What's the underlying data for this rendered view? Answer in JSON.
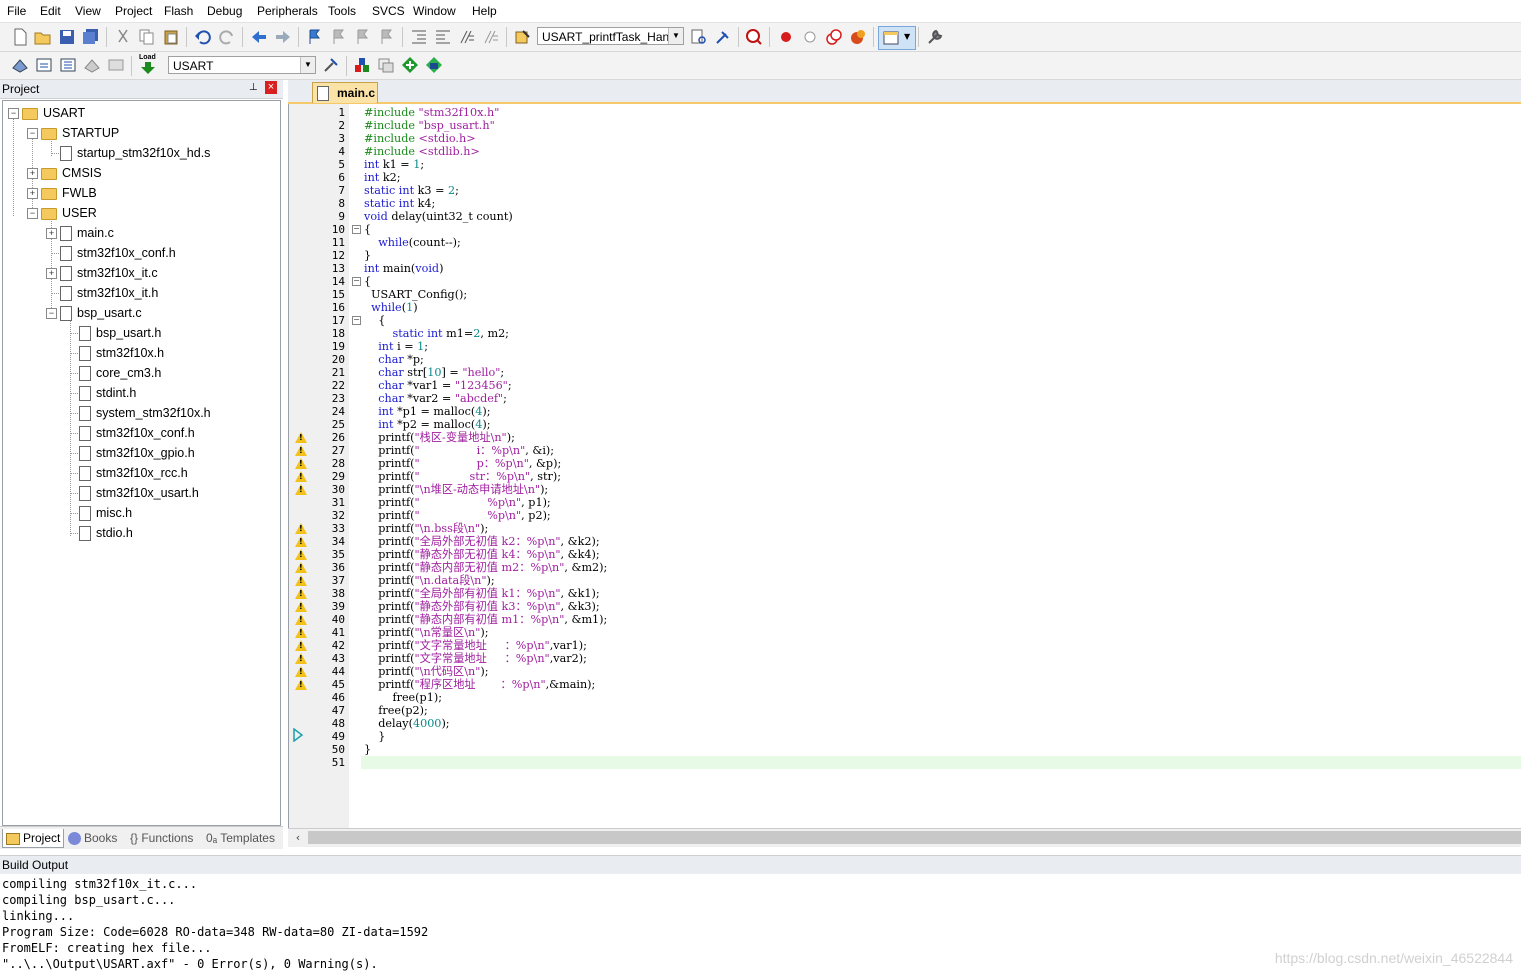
{
  "menu": [
    "File",
    "Edit",
    "View",
    "Project",
    "Flash",
    "Debug",
    "Peripherals",
    "Tools",
    "SVCS",
    "Window",
    "Help"
  ],
  "toolbar": {
    "function_combo": "USART_printfTask_Handl",
    "target_combo": "USART",
    "load_label": "Load"
  },
  "project_panel": {
    "title": "Project",
    "pin": "p",
    "close": "×",
    "tree": [
      {
        "label": "USART",
        "level": 0,
        "type": "root",
        "expander": "-"
      },
      {
        "label": "STARTUP",
        "level": 1,
        "type": "folder",
        "expander": "-"
      },
      {
        "label": "startup_stm32f10x_hd.s",
        "level": 2,
        "type": "file",
        "expander": ""
      },
      {
        "label": "CMSIS",
        "level": 1,
        "type": "folder",
        "expander": "+"
      },
      {
        "label": "FWLB",
        "level": 1,
        "type": "folder",
        "expander": "+"
      },
      {
        "label": "USER",
        "level": 1,
        "type": "folder",
        "expander": "-"
      },
      {
        "label": "main.c",
        "level": 2,
        "type": "file",
        "expander": "+"
      },
      {
        "label": "stm32f10x_conf.h",
        "level": 2,
        "type": "file",
        "expander": ""
      },
      {
        "label": "stm32f10x_it.c",
        "level": 2,
        "type": "file",
        "expander": "+"
      },
      {
        "label": "stm32f10x_it.h",
        "level": 2,
        "type": "file",
        "expander": ""
      },
      {
        "label": "bsp_usart.c",
        "level": 2,
        "type": "file",
        "expander": "-"
      },
      {
        "label": "bsp_usart.h",
        "level": 3,
        "type": "file",
        "expander": ""
      },
      {
        "label": "stm32f10x.h",
        "level": 3,
        "type": "file",
        "expander": ""
      },
      {
        "label": "core_cm3.h",
        "level": 3,
        "type": "file",
        "expander": ""
      },
      {
        "label": "stdint.h",
        "level": 3,
        "type": "file",
        "expander": ""
      },
      {
        "label": "system_stm32f10x.h",
        "level": 3,
        "type": "file",
        "expander": ""
      },
      {
        "label": "stm32f10x_conf.h",
        "level": 3,
        "type": "file",
        "expander": ""
      },
      {
        "label": "stm32f10x_gpio.h",
        "level": 3,
        "type": "file",
        "expander": ""
      },
      {
        "label": "stm32f10x_rcc.h",
        "level": 3,
        "type": "file",
        "expander": ""
      },
      {
        "label": "stm32f10x_usart.h",
        "level": 3,
        "type": "file",
        "expander": ""
      },
      {
        "label": "misc.h",
        "level": 3,
        "type": "file",
        "expander": ""
      },
      {
        "label": "stdio.h",
        "level": 3,
        "type": "file",
        "expander": ""
      }
    ],
    "tabs": [
      "Project",
      "Books",
      "{} Functions",
      "0ₐ Templates"
    ]
  },
  "editor": {
    "tab": "main.c",
    "lines": [
      {
        "n": "1",
        "w": false,
        "f": "",
        "t": [
          [
            "p",
            "#include "
          ],
          [
            "s",
            "\"stm32f10x.h\""
          ]
        ]
      },
      {
        "n": "2",
        "w": false,
        "f": "",
        "t": [
          [
            "p",
            "#include "
          ],
          [
            "s",
            "\"bsp_usart.h\""
          ]
        ]
      },
      {
        "n": "3",
        "w": false,
        "f": "",
        "t": [
          [
            "p",
            "#include "
          ],
          [
            "s",
            "<stdio.h>"
          ]
        ]
      },
      {
        "n": "4",
        "w": false,
        "f": "",
        "t": [
          [
            "p",
            "#include "
          ],
          [
            "s",
            "<stdlib.h>"
          ]
        ]
      },
      {
        "n": "5",
        "w": false,
        "f": "",
        "t": [
          [
            "k",
            "int"
          ],
          [
            "x",
            " k1 = "
          ],
          [
            "d",
            "1"
          ],
          [
            "x",
            ";"
          ]
        ]
      },
      {
        "n": "6",
        "w": false,
        "f": "",
        "t": [
          [
            "k",
            "int"
          ],
          [
            "x",
            " k2;"
          ]
        ]
      },
      {
        "n": "7",
        "w": false,
        "f": "",
        "t": [
          [
            "k",
            "static int"
          ],
          [
            "x",
            " k3 = "
          ],
          [
            "d",
            "2"
          ],
          [
            "x",
            ";"
          ]
        ]
      },
      {
        "n": "8",
        "w": false,
        "f": "",
        "t": [
          [
            "k",
            "static int"
          ],
          [
            "x",
            " k4;"
          ]
        ]
      },
      {
        "n": "9",
        "w": false,
        "f": "",
        "t": [
          [
            "k",
            "void"
          ],
          [
            "x",
            " delay(uint32_t count)"
          ]
        ]
      },
      {
        "n": "10",
        "w": false,
        "f": "-",
        "t": [
          [
            "x",
            "{"
          ]
        ]
      },
      {
        "n": "11",
        "w": false,
        "f": "",
        "t": [
          [
            "x",
            "    "
          ],
          [
            "k",
            "while"
          ],
          [
            "x",
            "(count--);"
          ]
        ]
      },
      {
        "n": "12",
        "w": false,
        "f": "",
        "t": [
          [
            "x",
            "}"
          ]
        ]
      },
      {
        "n": "13",
        "w": false,
        "f": "",
        "t": [
          [
            "k",
            "int"
          ],
          [
            "x",
            " main("
          ],
          [
            "k",
            "void"
          ],
          [
            "x",
            ")"
          ]
        ]
      },
      {
        "n": "14",
        "w": false,
        "f": "-",
        "t": [
          [
            "x",
            "{"
          ]
        ]
      },
      {
        "n": "15",
        "w": false,
        "f": "",
        "t": [
          [
            "x",
            "  USART_Config();"
          ]
        ]
      },
      {
        "n": "16",
        "w": false,
        "f": "",
        "t": [
          [
            "x",
            "  "
          ],
          [
            "k",
            "while"
          ],
          [
            "x",
            "("
          ],
          [
            "d",
            "1"
          ],
          [
            "x",
            ")"
          ]
        ]
      },
      {
        "n": "17",
        "w": false,
        "f": "-",
        "t": [
          [
            "x",
            "    {"
          ]
        ]
      },
      {
        "n": "18",
        "w": false,
        "f": "",
        "t": [
          [
            "x",
            "        "
          ],
          [
            "k",
            "static int"
          ],
          [
            "x",
            " m1="
          ],
          [
            "d",
            "2"
          ],
          [
            "x",
            ", m2;"
          ]
        ]
      },
      {
        "n": "19",
        "w": false,
        "f": "",
        "t": [
          [
            "x",
            "    "
          ],
          [
            "k",
            "int"
          ],
          [
            "x",
            " i = "
          ],
          [
            "d",
            "1"
          ],
          [
            "x",
            ";"
          ]
        ]
      },
      {
        "n": "20",
        "w": false,
        "f": "",
        "t": [
          [
            "x",
            "    "
          ],
          [
            "k",
            "char"
          ],
          [
            "x",
            " *p;"
          ]
        ]
      },
      {
        "n": "21",
        "w": false,
        "f": "",
        "t": [
          [
            "x",
            "    "
          ],
          [
            "k",
            "char"
          ],
          [
            "x",
            " str["
          ],
          [
            "d",
            "10"
          ],
          [
            "x",
            "] = "
          ],
          [
            "s",
            "\"hello\""
          ],
          [
            "x",
            ";"
          ]
        ]
      },
      {
        "n": "22",
        "w": false,
        "f": "",
        "t": [
          [
            "x",
            "    "
          ],
          [
            "k",
            "char"
          ],
          [
            "x",
            " *var1 = "
          ],
          [
            "s",
            "\"123456\""
          ],
          [
            "x",
            ";"
          ]
        ]
      },
      {
        "n": "23",
        "w": false,
        "f": "",
        "t": [
          [
            "x",
            "    "
          ],
          [
            "k",
            "char"
          ],
          [
            "x",
            " *var2 = "
          ],
          [
            "s",
            "\"abcdef\""
          ],
          [
            "x",
            ";"
          ]
        ]
      },
      {
        "n": "24",
        "w": false,
        "f": "",
        "t": [
          [
            "x",
            "    "
          ],
          [
            "k",
            "int"
          ],
          [
            "x",
            " *p1 = malloc("
          ],
          [
            "d",
            "4"
          ],
          [
            "x",
            ");"
          ]
        ]
      },
      {
        "n": "25",
        "w": false,
        "f": "",
        "t": [
          [
            "x",
            "    "
          ],
          [
            "k",
            "int"
          ],
          [
            "x",
            " *p2 = malloc("
          ],
          [
            "d",
            "4"
          ],
          [
            "x",
            ");"
          ]
        ]
      },
      {
        "n": "26",
        "w": true,
        "f": "",
        "t": [
          [
            "x",
            "    printf("
          ],
          [
            "s",
            "\"栈区-变量地址\\n\""
          ],
          [
            "x",
            ");"
          ]
        ]
      },
      {
        "n": "27",
        "w": true,
        "f": "",
        "t": [
          [
            "x",
            "    printf("
          ],
          [
            "s",
            "\"                i：%p\\n\""
          ],
          [
            "x",
            ", &i);"
          ]
        ]
      },
      {
        "n": "28",
        "w": true,
        "f": "",
        "t": [
          [
            "x",
            "    printf("
          ],
          [
            "s",
            "\"                p：%p\\n\""
          ],
          [
            "x",
            ", &p);"
          ]
        ]
      },
      {
        "n": "29",
        "w": true,
        "f": "",
        "t": [
          [
            "x",
            "    printf("
          ],
          [
            "s",
            "\"              str：%p\\n\""
          ],
          [
            "x",
            ", str);"
          ]
        ]
      },
      {
        "n": "30",
        "w": true,
        "f": "",
        "t": [
          [
            "x",
            "    printf("
          ],
          [
            "s",
            "\"\\n堆区-动态申请地址\\n\""
          ],
          [
            "x",
            ");"
          ]
        ]
      },
      {
        "n": "31",
        "w": false,
        "f": "",
        "t": [
          [
            "x",
            "    printf("
          ],
          [
            "s",
            "\"                   %p\\n\""
          ],
          [
            "x",
            ", p1);"
          ]
        ]
      },
      {
        "n": "32",
        "w": false,
        "f": "",
        "t": [
          [
            "x",
            "    printf("
          ],
          [
            "s",
            "\"                   %p\\n\""
          ],
          [
            "x",
            ", p2);"
          ]
        ]
      },
      {
        "n": "33",
        "w": true,
        "f": "",
        "t": [
          [
            "x",
            "    printf("
          ],
          [
            "s",
            "\"\\n.bss段\\n\""
          ],
          [
            "x",
            ");"
          ]
        ]
      },
      {
        "n": "34",
        "w": true,
        "f": "",
        "t": [
          [
            "x",
            "    printf("
          ],
          [
            "s",
            "\"全局外部无初值 k2：%p\\n\""
          ],
          [
            "x",
            ", &k2);"
          ]
        ]
      },
      {
        "n": "35",
        "w": true,
        "f": "",
        "t": [
          [
            "x",
            "    printf("
          ],
          [
            "s",
            "\"静态外部无初值 k4：%p\\n\""
          ],
          [
            "x",
            ", &k4);"
          ]
        ]
      },
      {
        "n": "36",
        "w": true,
        "f": "",
        "t": [
          [
            "x",
            "    printf("
          ],
          [
            "s",
            "\"静态内部无初值 m2：%p\\n\""
          ],
          [
            "x",
            ", &m2);"
          ]
        ]
      },
      {
        "n": "37",
        "w": true,
        "f": "",
        "t": [
          [
            "x",
            "    printf("
          ],
          [
            "s",
            "\"\\n.data段\\n\""
          ],
          [
            "x",
            ");"
          ]
        ]
      },
      {
        "n": "38",
        "w": true,
        "f": "",
        "t": [
          [
            "x",
            "    printf("
          ],
          [
            "s",
            "\"全局外部有初值 k1：%p\\n\""
          ],
          [
            "x",
            ", &k1);"
          ]
        ]
      },
      {
        "n": "39",
        "w": true,
        "f": "",
        "t": [
          [
            "x",
            "    printf("
          ],
          [
            "s",
            "\"静态外部有初值 k3：%p\\n\""
          ],
          [
            "x",
            ", &k3);"
          ]
        ]
      },
      {
        "n": "40",
        "w": true,
        "f": "",
        "t": [
          [
            "x",
            "    printf("
          ],
          [
            "s",
            "\"静态内部有初值 m1：%p\\n\""
          ],
          [
            "x",
            ", &m1);"
          ]
        ]
      },
      {
        "n": "41",
        "w": true,
        "f": "",
        "t": [
          [
            "x",
            "    printf("
          ],
          [
            "s",
            "\"\\n常量区\\n\""
          ],
          [
            "x",
            ");"
          ]
        ]
      },
      {
        "n": "42",
        "w": true,
        "f": "",
        "t": [
          [
            "x",
            "    printf("
          ],
          [
            "s",
            "\"文字常量地址     ：%p\\n\""
          ],
          [
            "x",
            ",var1);"
          ]
        ]
      },
      {
        "n": "43",
        "w": true,
        "f": "",
        "t": [
          [
            "x",
            "    printf("
          ],
          [
            "s",
            "\"文字常量地址     ：%p\\n\""
          ],
          [
            "x",
            ",var2);"
          ]
        ]
      },
      {
        "n": "44",
        "w": true,
        "f": "",
        "t": [
          [
            "x",
            "    printf("
          ],
          [
            "s",
            "\"\\n代码区\\n\""
          ],
          [
            "x",
            ");"
          ]
        ]
      },
      {
        "n": "45",
        "w": true,
        "f": "",
        "t": [
          [
            "x",
            "    printf("
          ],
          [
            "s",
            "\"程序区地址       ：%p\\n\""
          ],
          [
            "x",
            ",&main);"
          ]
        ]
      },
      {
        "n": "46",
        "w": false,
        "f": "",
        "t": [
          [
            "x",
            "        free(p1);"
          ]
        ]
      },
      {
        "n": "47",
        "w": false,
        "f": "",
        "t": [
          [
            "x",
            "    free(p2);"
          ]
        ]
      },
      {
        "n": "48",
        "w": false,
        "f": "",
        "t": [
          [
            "x",
            "    delay("
          ],
          [
            "d",
            "4000"
          ],
          [
            "x",
            ");"
          ]
        ]
      },
      {
        "n": "49",
        "w": false,
        "f": "",
        "t": [
          [
            "x",
            "    }"
          ]
        ]
      },
      {
        "n": "50",
        "w": false,
        "f": "",
        "t": [
          [
            "x",
            "}"
          ]
        ]
      },
      {
        "n": "51",
        "w": false,
        "f": "",
        "t": [
          [
            "x",
            ""
          ]
        ]
      }
    ]
  },
  "build_output": {
    "title": "Build Output",
    "lines": [
      "compiling stm32f10x_it.c...",
      "compiling bsp_usart.c...",
      "linking...",
      "Program Size: Code=6028 RO-data=348 RW-data=80 ZI-data=1592",
      "FromELF: creating hex file...",
      "\"..\\..\\Output\\USART.axf\" - 0 Error(s), 0 Warning(s)."
    ]
  },
  "watermark": "https://blog.csdn.net/weixin_46522844",
  "colors": {
    "keyword": "#1c1cd0",
    "string": "#a020a0",
    "number": "#0a8a8a",
    "tab_active": "#fbe2a7",
    "current_line": "#e6fae6",
    "warning": "#f2c21a"
  }
}
